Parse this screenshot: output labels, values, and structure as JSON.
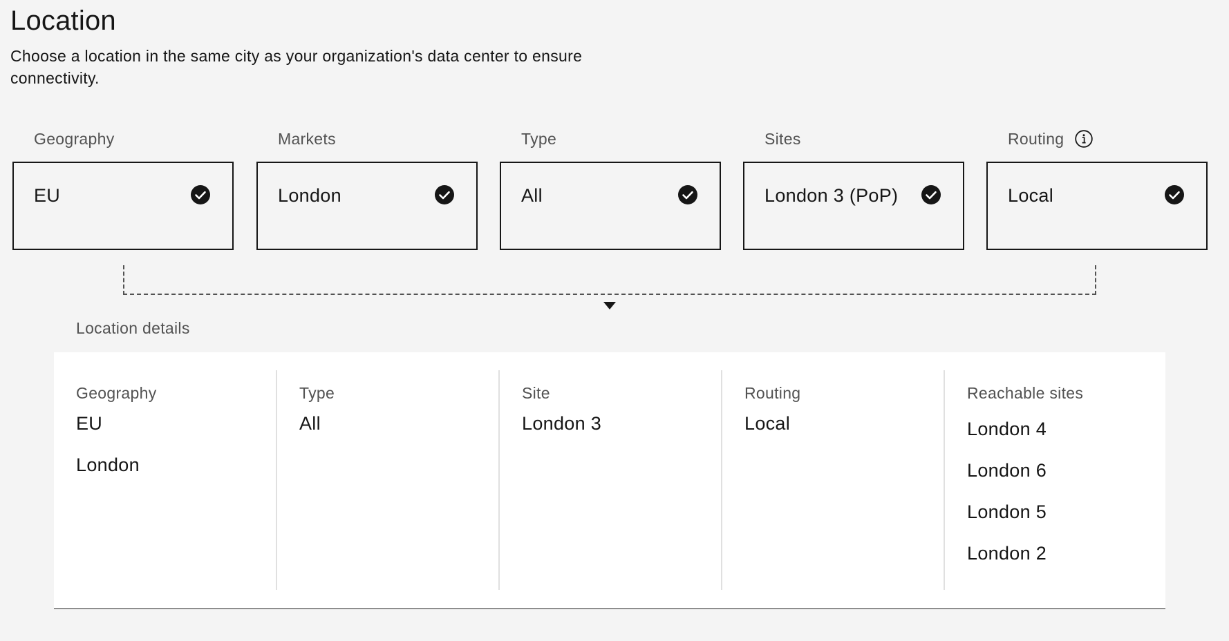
{
  "header": {
    "title": "Location",
    "description": "Choose a location in the same city as your organization's data center to ensure connectivity."
  },
  "selectors": [
    {
      "label": "Geography",
      "value": "EU",
      "selected": true
    },
    {
      "label": "Markets",
      "value": "London",
      "selected": true
    },
    {
      "label": "Type",
      "value": "All",
      "selected": true
    },
    {
      "label": "Sites",
      "value": "London 3 (PoP)",
      "selected": true
    },
    {
      "label": "Routing",
      "value": "Local",
      "selected": true,
      "has_info_icon": true
    }
  ],
  "icons": {
    "selected": "checkmark-filled-icon",
    "info": "information-icon",
    "connector": "caret-down-icon"
  },
  "details": {
    "heading": "Location details",
    "columns": [
      {
        "label": "Geography",
        "values": [
          "EU",
          "London"
        ]
      },
      {
        "label": "Type",
        "values": [
          "All"
        ]
      },
      {
        "label": "Site",
        "values": [
          "London 3"
        ]
      },
      {
        "label": "Routing",
        "values": [
          "Local"
        ]
      },
      {
        "label": "Reachable sites",
        "values": [
          "London 4",
          "London 6",
          "London 5",
          "London 2"
        ]
      }
    ]
  },
  "colors": {
    "background": "#f4f4f4",
    "text_primary": "#161616",
    "text_secondary": "#525252",
    "panel": "#ffffff",
    "divider": "#e0e0e0"
  }
}
